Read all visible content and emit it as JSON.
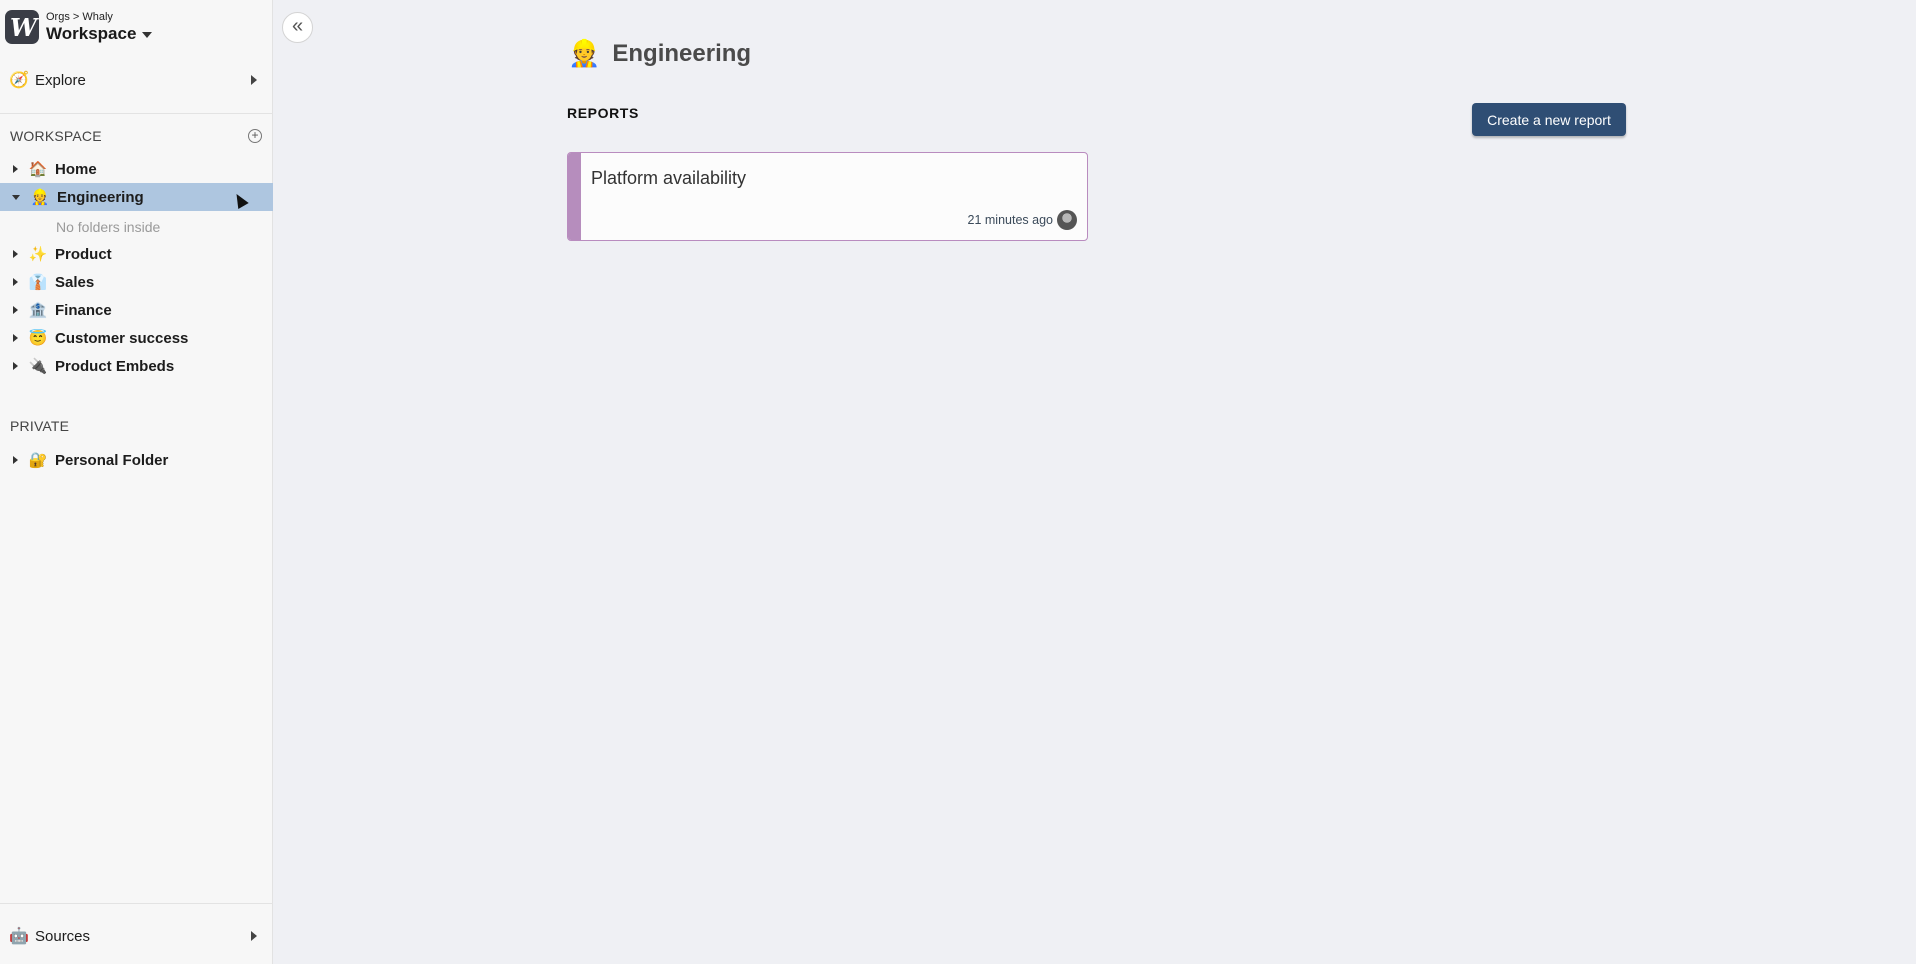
{
  "brand": {
    "logo_glyph": "W",
    "breadcrumb": "Orgs > Whaly",
    "workspace_label": "Workspace"
  },
  "nav": {
    "explore_icon": "🧭",
    "explore_label": "Explore",
    "sources_icon": "🤖",
    "sources_label": "Sources"
  },
  "workspace_section": {
    "heading": "WORKSPACE",
    "add_icon": "+"
  },
  "tree": [
    {
      "icon": "🏠",
      "label": "Home"
    },
    {
      "icon": "👷",
      "label": "Engineering"
    },
    {
      "icon": "✨",
      "label": "Product"
    },
    {
      "icon": "👔",
      "label": "Sales"
    },
    {
      "icon": "🏦",
      "label": "Finance"
    },
    {
      "icon": "😇",
      "label": "Customer success"
    },
    {
      "icon": "🔌",
      "label": "Product Embeds"
    }
  ],
  "engineering_empty": "No folders inside",
  "private_section": {
    "heading": "PRIVATE",
    "items": [
      {
        "icon": "🔐",
        "label": "Personal Folder"
      }
    ]
  },
  "collapse_glyph": "«",
  "main": {
    "title_icon": "👷",
    "title": "Engineering",
    "reports_heading": "REPORTS",
    "create_button": "Create a new report",
    "reports": [
      {
        "title": "Platform availability",
        "updated": "21 minutes ago"
      }
    ]
  },
  "colors": {
    "sidebar_selected": "#aec6e0",
    "primary_button": "#2f4e74",
    "card_accent": "#b68dbd"
  }
}
